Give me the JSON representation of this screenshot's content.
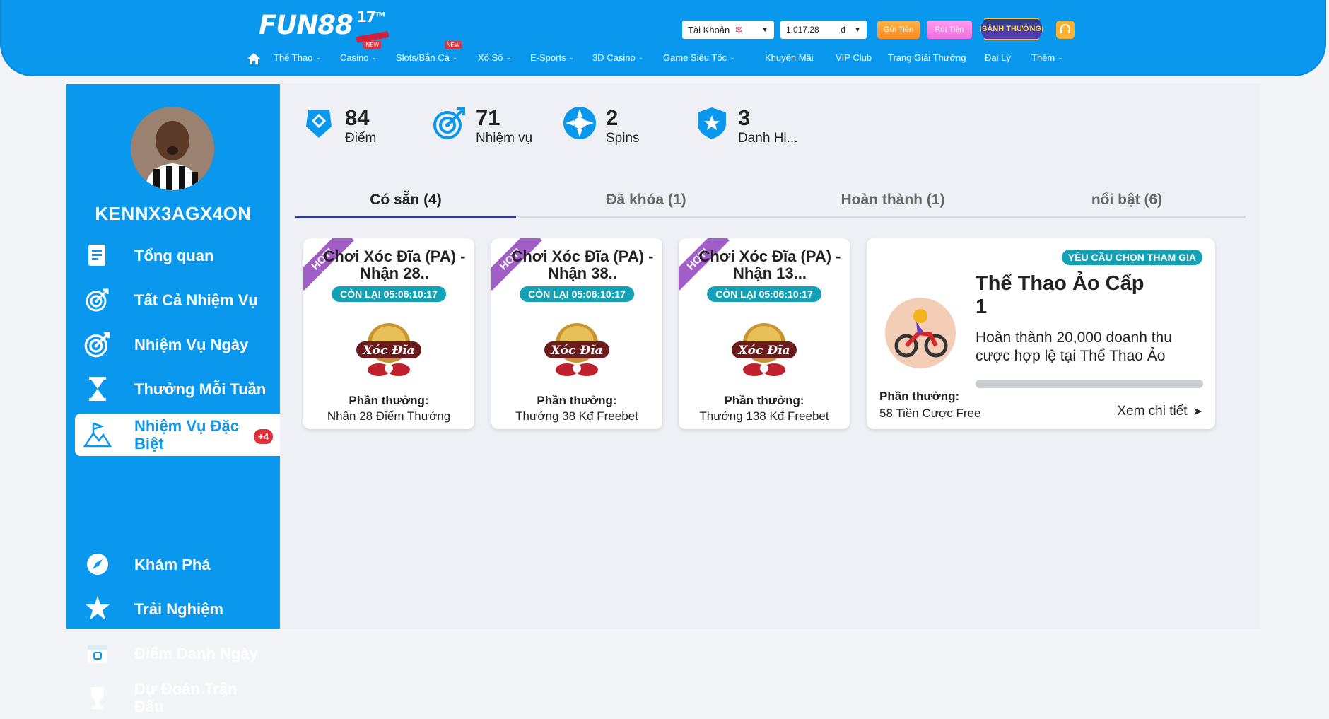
{
  "header": {
    "logo_text": "FUN88",
    "logo_anniversary": "17",
    "account_select": "Tài Khoản",
    "balance": "1,017.28",
    "currency": "đ",
    "deposit_label": "Gửi Tiền",
    "withdraw_label": "Rút Tiền",
    "reward_hall_label": "SẢNH THƯỞNG",
    "new_badge": "NEW",
    "nav": [
      {
        "label": "Thể Thao"
      },
      {
        "label": "Casino"
      },
      {
        "label": "Slots/Bắn Cá"
      },
      {
        "label": "Xổ Số"
      },
      {
        "label": "E-Sports"
      },
      {
        "label": "3D Casino"
      },
      {
        "label": "Game Siêu Tốc"
      },
      {
        "label": "Khuyến Mãi"
      },
      {
        "label": "VIP Club"
      },
      {
        "label": "Trang Giải Thưởng"
      },
      {
        "label": "Đại Lý"
      },
      {
        "label": "Thêm"
      }
    ]
  },
  "sidebar": {
    "username": "KENNX3AGX4ON",
    "items": [
      {
        "label": "Tổng quan",
        "icon": "document-icon"
      },
      {
        "label": "Tất Cả Nhiệm Vụ",
        "icon": "target-icon"
      },
      {
        "label": "Nhiệm Vụ Ngày",
        "icon": "target-icon"
      },
      {
        "label": "Thưởng Mỗi Tuần",
        "icon": "hourglass-icon"
      },
      {
        "label": "Nhiệm Vụ Đặc Biệt",
        "icon": "flag-mountain-icon",
        "badge": "+4",
        "active": true
      },
      {
        "label": "Khám Phá",
        "icon": "compass-icon"
      },
      {
        "label": "Trải Nghiệm",
        "icon": "star-burst-icon"
      },
      {
        "label": "Điểm Danh Ngày",
        "icon": "calendar-icon"
      },
      {
        "label": "Dự Đoán Trận Đấu",
        "icon": "trophy-icon"
      }
    ]
  },
  "stats": [
    {
      "value": "84",
      "label": "Điểm"
    },
    {
      "value": "71",
      "label": "Nhiệm vụ"
    },
    {
      "value": "2",
      "label": "Spins"
    },
    {
      "value": "3",
      "label": "Danh Hi..."
    }
  ],
  "tabs": [
    {
      "label": "Có sẵn (4)",
      "active": true
    },
    {
      "label": "Đã khóa (1)"
    },
    {
      "label": "Hoàn thành (1)"
    },
    {
      "label": "nổi bật (6)"
    }
  ],
  "cards": [
    {
      "ribbon": "HOT!",
      "title": "Chơi Xóc Đĩa (PA) - Nhận 28..",
      "countdown": "CÒN LẠI 05:06:10:17",
      "reward_label": "Phần thưởng:",
      "reward_value": "Nhận 28 Điểm Thưởng",
      "game_logo": "Xóc Đĩa"
    },
    {
      "ribbon": "HOT!",
      "title": "Chơi Xóc Đĩa (PA) - Nhận 38..",
      "countdown": "CÒN LẠI 05:06:10:17",
      "reward_label": "Phần thưởng:",
      "reward_value": "Thưởng 38 Kđ Freebet",
      "game_logo": "Xóc Đĩa"
    },
    {
      "ribbon": "HOT!",
      "title": "Chơi Xóc Đĩa (PA) - Nhận 13...",
      "countdown": "CÒN LẠI 05:06:10:17",
      "reward_label": "Phần thưởng:",
      "reward_value": "Thưởng 138 Kđ Freebet",
      "game_logo": "Xóc Đĩa"
    }
  ],
  "featured": {
    "optin": "YÊU CẦU CHỌN THAM GIA",
    "title": "Thể Thao Ảo Cấp 1",
    "description": "Hoàn thành 20,000 doanh thu cược hợp lệ tại Thể Thao Ảo",
    "progress": 0,
    "reward_label": "Phần thưởng:",
    "reward_value": "58 Tiền Cược Free",
    "detail_label": "Xem chi tiết"
  },
  "colors": {
    "brand_blue": "#0a98ee",
    "teal": "#13a1b5",
    "hot_purple": "#a15ec7",
    "tab_active": "#2c3e8f"
  }
}
